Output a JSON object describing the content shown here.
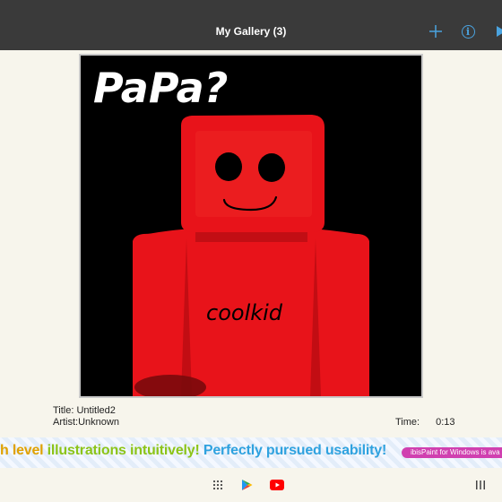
{
  "header": {
    "title": "My Gallery (3)",
    "icons": [
      "add-icon",
      "info-icon",
      "play-icon"
    ]
  },
  "artwork": {
    "caption_text": "PaPa?",
    "shirt_text": "coolkid",
    "colors": {
      "background": "#000000",
      "figure_red": "#e8131a",
      "figure_dark_red": "#a80c10",
      "eyes": "#000000",
      "text": "#ffffff"
    }
  },
  "info": {
    "title": "Title: Untitled2",
    "artist": "Artist:Unknown",
    "time_label": "Time:",
    "time_value": "0:13"
  },
  "ad": {
    "part1": "h level",
    "part2": "illustrations",
    "part3": "intuitively!",
    "part4": "Perfectly pursued usability!",
    "pill": "ibisPaint for Windows is ava"
  },
  "navbar": {
    "icons": [
      "apps-grid-icon",
      "play-store-icon",
      "youtube-icon",
      "recents-icon"
    ]
  }
}
